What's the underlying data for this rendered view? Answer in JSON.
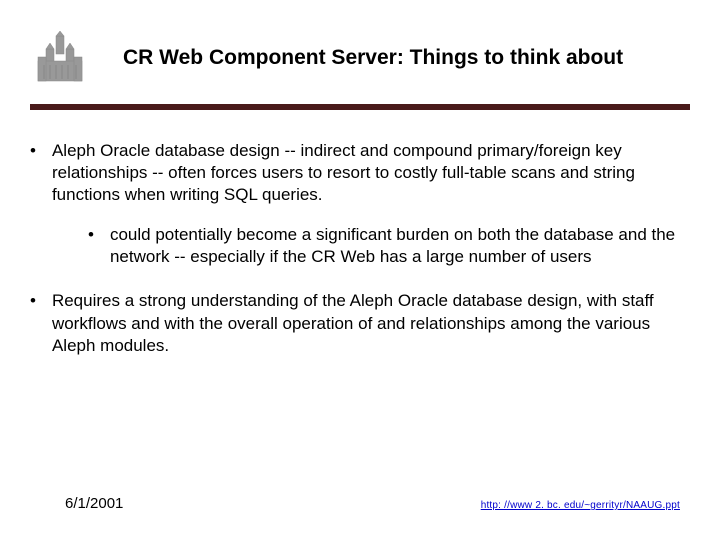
{
  "header": {
    "title": "CR Web Component Server: Things to think about"
  },
  "bullets": {
    "item1": "Aleph Oracle database design -- indirect and compound primary/foreign key relationships  -- often forces users to resort to costly full-table scans and string functions when writing SQL queries.",
    "item1_sub1": "could potentially become a significant burden on both the database and the network -- especially if the CR Web has a large number of users",
    "item2": "Requires a strong understanding of the Aleph Oracle database design, with staff workflows and with the overall operation of and relationships among the various Aleph modules."
  },
  "footer": {
    "date": "6/1/2001",
    "link_text": "http: //www 2. bc. edu/~gerrityr/NAAUG.ppt"
  }
}
